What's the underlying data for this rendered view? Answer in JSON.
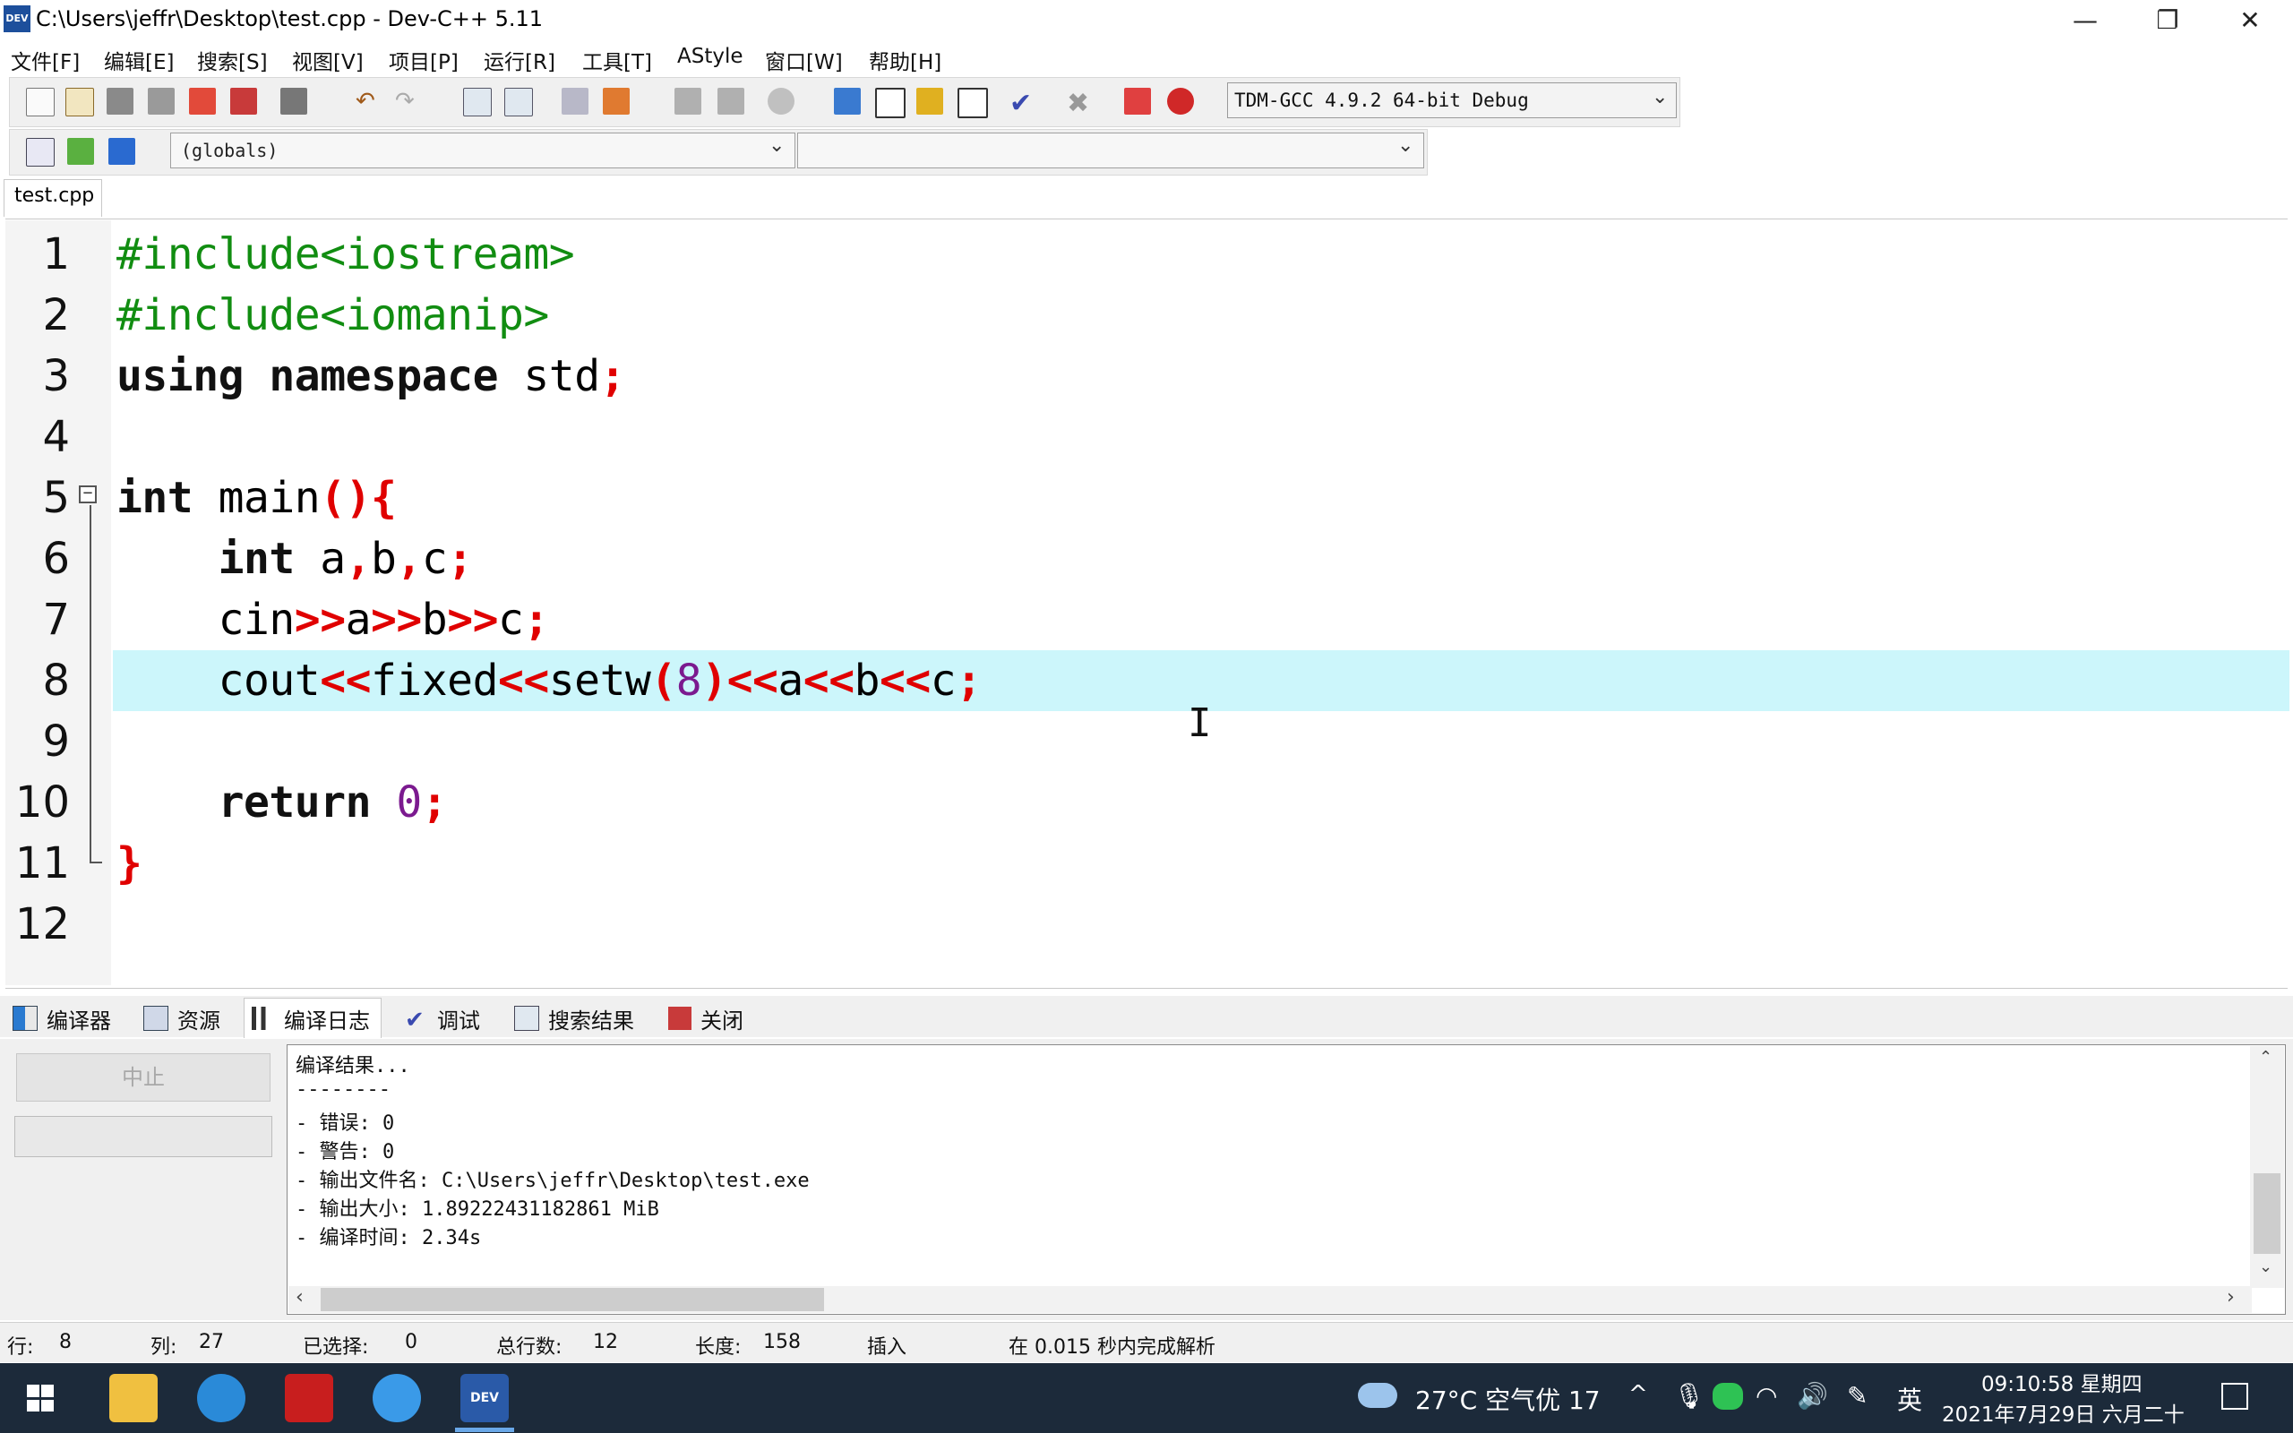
{
  "window": {
    "title": "C:\\Users\\jeffr\\Desktop\\test.cpp - Dev-C++ 5.11",
    "app_icon_text": "DEV",
    "min_glyph": "—",
    "max_glyph": "❐",
    "close_glyph": "✕"
  },
  "menu": [
    "文件[F]",
    "编辑[E]",
    "搜索[S]",
    "视图[V]",
    "项目[P]",
    "运行[R]",
    "工具[T]",
    "AStyle",
    "窗口[W]",
    "帮助[H]"
  ],
  "toolbar": {
    "compiler": "TDM-GCC 4.9.2 64-bit Debug",
    "scope_combo": "(globals)",
    "member_combo": ""
  },
  "file_tab": "test.cpp",
  "editor": {
    "line_numbers": [
      "1",
      "2",
      "3",
      "4",
      "5",
      "6",
      "7",
      "8",
      "9",
      "10",
      "11",
      "12"
    ],
    "current_line_index": 8
  },
  "bottom_tabs": [
    "编译器",
    "资源",
    "编译日志",
    "调试",
    "搜索结果",
    "关闭"
  ],
  "compile_panel": {
    "abort_label": "中止",
    "log": [
      "编译结果...",
      "--------",
      "- 错误: 0",
      "- 警告: 0",
      "- 输出文件名: C:\\Users\\jeffr\\Desktop\\test.exe",
      "- 输出大小: 1.89222431182861 MiB",
      "- 编译时间: 2.34s"
    ]
  },
  "status": {
    "row_label": "行:",
    "row": "8",
    "col_label": "列:",
    "col": "27",
    "sel_label": "已选择:",
    "sel": "0",
    "total_label": "总行数:",
    "total": "12",
    "len_label": "长度:",
    "len": "158",
    "mode": "插入",
    "parse": "在 0.015 秒内完成解析"
  },
  "taskbar": {
    "weather": "27°C 空气优 17",
    "ime": "英",
    "time": "09:10:58 星期四",
    "date": "2021年7月29日 六月二十",
    "tray_chevron": "^"
  },
  "colors": {
    "highlight_line": "#ccf6fb",
    "preprocessor": "#118d11",
    "operator": "#e00000",
    "number": "#7b1a8f",
    "taskbar": "#1c2a3a"
  }
}
